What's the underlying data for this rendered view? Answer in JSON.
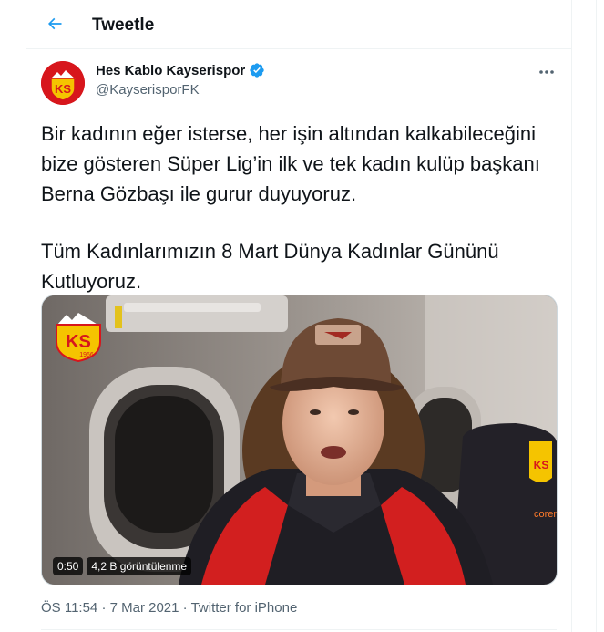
{
  "header": {
    "back_icon": "arrow-left-icon",
    "title": "Tweetle"
  },
  "tweet": {
    "author": {
      "name": "Hes Kablo Kayserispor",
      "handle": "@KayserisporFK",
      "verified_icon": "verified-badge-icon",
      "avatar_text": "KS"
    },
    "more_icon": "more-dots-icon",
    "paragraphs": [
      "Bir kadının eğer isterse, her işin altından kalkabileceğini bize gösteren Süper Lig’in ilk ve tek kadın kulüp başkanı Berna Gözbaşı ile gurur duyuyoruz.",
      "Tüm Kadınlarımızın 8 Mart Dünya Kadınlar Gününü Kutluyoruz."
    ],
    "video": {
      "watermark_text": "KS",
      "watermark_year": "1966",
      "duration": "0:50",
      "views": "4,2 B görüntülenme",
      "seat_brand": "corendon",
      "seat_badge": "KS"
    },
    "meta": {
      "time": "ÖS 11:54",
      "separator": "·",
      "date": "7 Mar 2021",
      "source": "Twitter for iPhone"
    }
  },
  "colors": {
    "accent": "#1d9bf0",
    "text": "#0f1419",
    "secondary": "#536471",
    "club_red": "#d7161c",
    "club_yellow": "#f5c400"
  }
}
